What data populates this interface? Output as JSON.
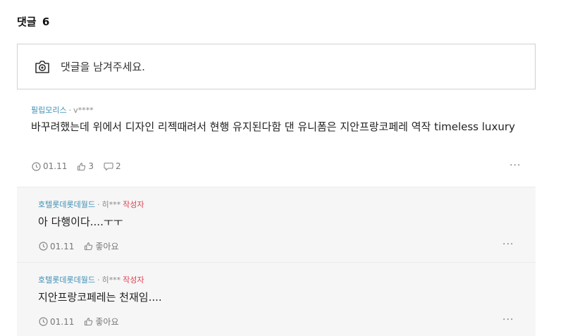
{
  "header": {
    "title": "댓글",
    "count": "6"
  },
  "input": {
    "placeholder": "댓글을 남겨주세요.",
    "icon": "camera-icon"
  },
  "comments": [
    {
      "author": "필립모리스",
      "separator": "·",
      "user_id": "v****",
      "text": "바꾸려했는데 위에서 디자인 리젝때려서 현행 유지된다함 댄 유니폼은 지안프랑코페레 역작 timeless luxury",
      "date": "01.11",
      "likes": "3",
      "replies": "2",
      "more": "···"
    }
  ],
  "replies": [
    {
      "author": "호텔롯데롯데월드",
      "separator": "·",
      "user_id": "히***",
      "badge": "작성자",
      "text": "아 다행이다....ㅜㅜ",
      "date": "01.11",
      "like_label": "좋아요",
      "more": "···"
    },
    {
      "author": "호텔롯데롯데월드",
      "separator": "·",
      "user_id": "히***",
      "badge": "작성자",
      "text": "지안프랑코페레는 천재임....",
      "date": "01.11",
      "like_label": "좋아요",
      "more": "···"
    }
  ],
  "colors": {
    "author": "#3d8fb5",
    "badge": "#e0404f",
    "reply_bg": "#f6f6f6"
  }
}
